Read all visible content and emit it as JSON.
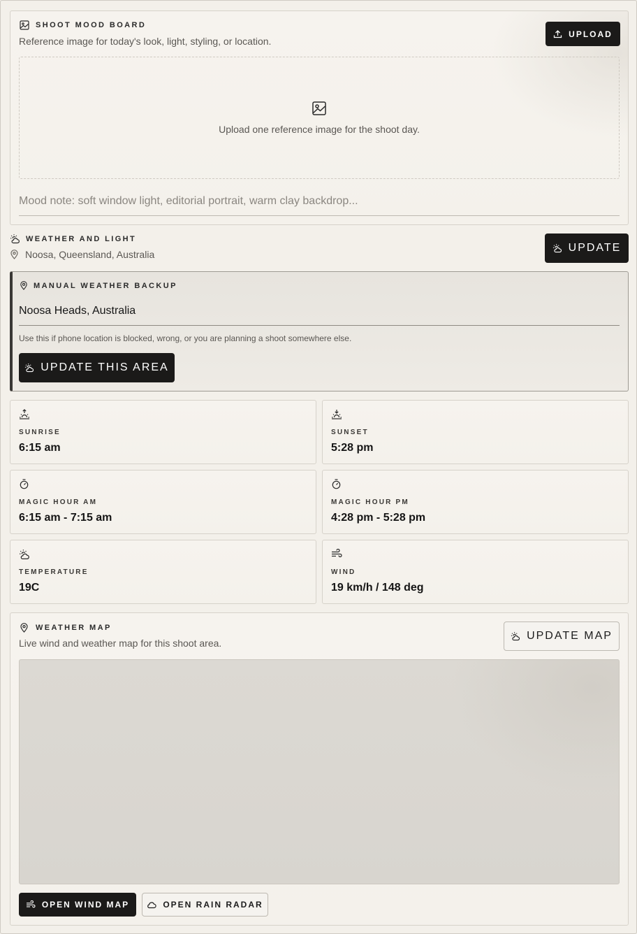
{
  "mood_board": {
    "title": "SHOOT MOOD BOARD",
    "subtitle": "Reference image for today's look, light, styling, or location.",
    "upload_label": "UPLOAD",
    "dropzone_text": "Upload one reference image for the shoot day.",
    "note_placeholder": "Mood note: soft window light, editorial portrait, warm clay backdrop..."
  },
  "weather": {
    "title": "WEATHER AND LIGHT",
    "location": "Noosa, Queensland, Australia",
    "update_label": "UPDATE"
  },
  "manual_backup": {
    "title": "MANUAL WEATHER BACKUP",
    "location_value": "Noosa Heads, Australia",
    "help_text": "Use this if phone location is blocked, wrong, or you are planning a shoot somewhere else.",
    "update_area_label": "UPDATE THIS AREA"
  },
  "stats": [
    {
      "label": "SUNRISE",
      "value": "6:15 am",
      "icon": "sunrise-icon"
    },
    {
      "label": "SUNSET",
      "value": "5:28 pm",
      "icon": "sunset-icon"
    },
    {
      "label": "MAGIC HOUR AM",
      "value": "6:15 am - 7:15 am",
      "icon": "timer-icon"
    },
    {
      "label": "MAGIC HOUR PM",
      "value": "4:28 pm - 5:28 pm",
      "icon": "timer-icon"
    },
    {
      "label": "TEMPERATURE",
      "value": "19C",
      "icon": "cloud-sun-icon"
    },
    {
      "label": "WIND",
      "value": "19 km/h / 148 deg",
      "icon": "wind-icon"
    }
  ],
  "weather_map": {
    "title": "WEATHER MAP",
    "subtitle": "Live wind and weather map for this shoot area.",
    "update_map_label": "UPDATE MAP",
    "open_wind_label": "OPEN WIND MAP",
    "open_radar_label": "OPEN RAIN RADAR"
  },
  "colors": {
    "background": "#f3f0ea",
    "dark_button": "#1b1a19",
    "border": "#d6d2ca",
    "accent_bar": "#3a3835"
  }
}
